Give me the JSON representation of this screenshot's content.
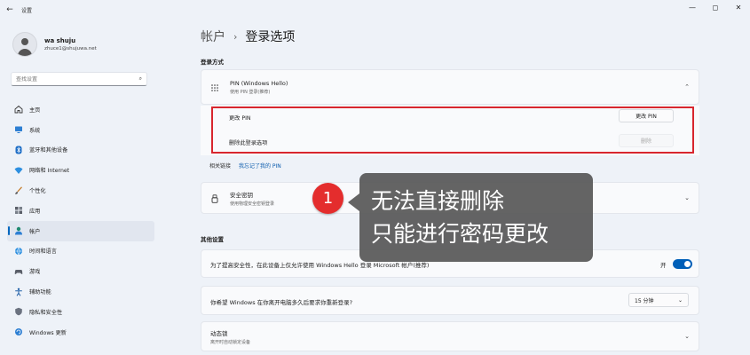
{
  "window": {
    "title": "设置",
    "back": "←",
    "controls": [
      "—",
      "◻",
      "✕"
    ]
  },
  "user": {
    "name": "wa shuju",
    "email": "zhuce1@shujuwa.net"
  },
  "search": {
    "placeholder": "查找设置"
  },
  "sidebar": {
    "items": [
      {
        "label": "主页",
        "icon": "home-icon"
      },
      {
        "label": "系统",
        "icon": "system-icon"
      },
      {
        "label": "蓝牙和其他设备",
        "icon": "bluetooth-icon"
      },
      {
        "label": "网络和 Internet",
        "icon": "wifi-icon"
      },
      {
        "label": "个性化",
        "icon": "brush-icon"
      },
      {
        "label": "应用",
        "icon": "apps-icon"
      },
      {
        "label": "帐户",
        "icon": "account-icon",
        "active": true
      },
      {
        "label": "时间和语言",
        "icon": "globe-icon"
      },
      {
        "label": "游戏",
        "icon": "gamepad-icon"
      },
      {
        "label": "辅助功能",
        "icon": "accessibility-icon"
      },
      {
        "label": "隐私和安全性",
        "icon": "shield-icon"
      },
      {
        "label": "Windows 更新",
        "icon": "update-icon"
      }
    ]
  },
  "breadcrumb": {
    "parent": "帐户",
    "separator": "›",
    "current": "登录选项"
  },
  "signin": {
    "section_label": "登录方式",
    "pin": {
      "title": "PIN (Windows Hello)",
      "subtitle": "使用 PIN 登录(推荐)",
      "change_label": "更改 PIN",
      "change_button": "更改 PIN",
      "remove_label": "删除此登录选项",
      "remove_button": "删除"
    },
    "related": {
      "label": "相关链接",
      "link": "我忘记了我的 PIN"
    },
    "key": {
      "title": "安全密钥",
      "subtitle": "使用物理安全密钥登录"
    }
  },
  "other": {
    "section_label": "其他设置",
    "hello_only": {
      "label": "为了提高安全性，在此设备上仅允许使用 Windows Hello 登录 Microsoft 帐户(推荐)",
      "state": "开"
    },
    "away": {
      "label": "你希望 Windows 在你离开电脑多久后要求你重新登录?",
      "value": "15 分钟"
    },
    "dynamic_lock": {
      "title": "动态锁",
      "subtitle": "离开时自动锁定设备"
    }
  },
  "callout": {
    "badge": "1",
    "line1": "无法直接删除",
    "line2": "只能进行密码更改"
  },
  "colors": {
    "accent": "#0067c0",
    "highlight_border": "#d8262e",
    "badge": "#e42d2d",
    "callout_bg": "#585858"
  }
}
